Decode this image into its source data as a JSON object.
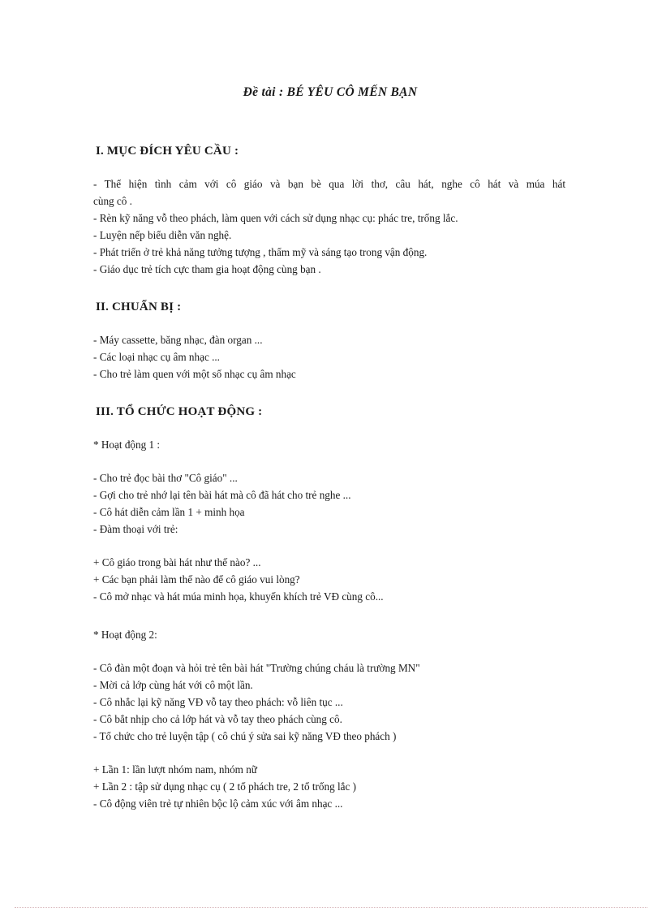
{
  "document": {
    "title": "Đề tài : BÉ YÊU CÔ MẾN BẠN",
    "sections": [
      {
        "heading": "I. MỤC ĐÍCH YÊU CẦU :",
        "lines": [
          "- Thể hiện tình cảm với cô giáo và bạn bè qua lời thơ, câu hát, nghe cô hát và múa hát",
          "cùng cô .",
          "- Rèn kỹ năng vỗ theo phách, làm quen với cách sử dụng nhạc cụ: phác tre, trống lắc.",
          "- Luyện nếp biểu diễn văn nghệ.",
          "- Phát triển ở trẻ khả năng tưởng tượng , thẩm mỹ và sáng tạo trong vận động.",
          "- Giáo dục trẻ tích cực tham gia hoạt động cùng bạn ."
        ]
      },
      {
        "heading": "II. CHUẨN BỊ :",
        "lines": [
          "- Máy cassette, băng nhạc, đàn organ ...",
          "- Các loại nhạc cụ âm nhạc ...",
          "- Cho trẻ làm quen với một số nhạc cụ âm nhạc"
        ]
      },
      {
        "heading": "III. TỔ CHỨC HOẠT ĐỘNG :",
        "activity_one_label": "* Hoạt động 1 :",
        "activity_one_lines": [
          "- Cho trẻ đọc bài thơ \"Cô giáo\" ...",
          "- Gợi cho trẻ nhớ lại tên bài hát mà cô đã hát cho trẻ nghe ...",
          "- Cô hát diễn cảm lần 1 + minh  họa",
          "- Đàm thoại với trẻ:"
        ],
        "activity_one_questions": [
          "+ Cô giáo trong bài hát như thế nào? ...",
          "+ Các bạn phải làm thế nào để cô giáo vui lòng?",
          "- Cô mở nhạc và hát múa minh  họa, khuyến khích trẻ VĐ cùng cô..."
        ],
        "activity_two_label": "* Hoạt động 2:",
        "activity_two_lines": [
          "- Cô đàn một đoạn và hỏi trẻ tên bài hát \"Trường  chúng  cháu là trường MN\"",
          "- Mời cả lớp cùng hát với cô một lần.",
          "- Cô nhắc lại kỹ năng VĐ vỗ tay theo phách: vỗ liên tục ...",
          "- Cô bắt nhịp cho cả lớp hát và vỗ tay theo phách cùng cô.",
          "- Tổ chức cho trẻ luyện tập ( cô chú ý sửa sai kỹ năng VĐ theo phách )"
        ],
        "activity_two_rounds": [
          "+ Lần 1: lần lượt nhóm nam, nhóm nữ",
          "+ Lần 2 : tập sử dụng nhạc cụ ( 2 tổ phách tre, 2 tổ trống lắc )",
          "- Cô động viên  trẻ tự nhiên  bộc lộ cảm xúc với  âm nhạc ..."
        ]
      }
    ]
  }
}
